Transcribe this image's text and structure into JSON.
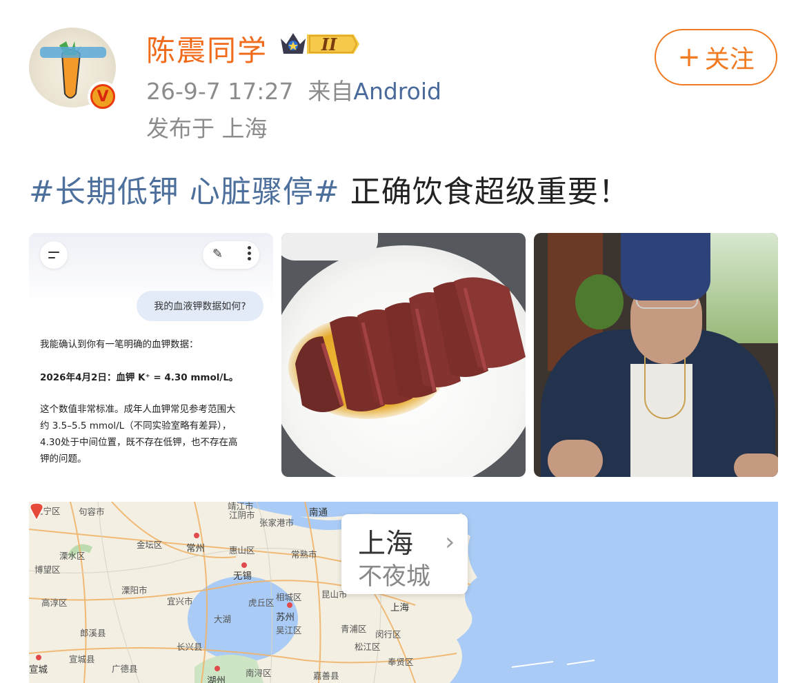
{
  "header": {
    "username": "陈震同学",
    "level_badge": "II",
    "timestamp": "26-9-7 17:27",
    "source_prefix": "来自",
    "source_app": "Android",
    "location_line": "发布于 上海",
    "follow_label": "关注"
  },
  "post": {
    "hashtag": "#长期低钾 心脏骤停#",
    "text": " 正确饮食超级重要！"
  },
  "images": {
    "screenshot": {
      "question": "我的血液钾数据如何?",
      "answer_intro": "我能确认到你有一笔明确的血钾数据：",
      "answer_value": "2026年4月2日：血钾 K⁺ = 4.30 mmol/L。",
      "answer_line1": "这个数值非常标准。成年人血钾常见参考范围大",
      "answer_line2": "约 3.5–5.5 mmol/L（不同实验室略有差异），",
      "answer_line3": "4.30处于中间位置，既不存在低钾，也不存在高",
      "answer_line4": "钾的问题。"
    }
  },
  "map": {
    "popup_title": "上海",
    "popup_subtitle": "不夜城",
    "labels": [
      "江宁区",
      "句容市",
      "靖江市",
      "江阴市",
      "南通",
      "张家港市",
      "金坛区",
      "常州",
      "惠山区",
      "常熟市",
      "溧水区",
      "无锡",
      "博望区",
      "溧阳市",
      "宜兴市",
      "相城区",
      "昆山市",
      "虎丘区",
      "苏州",
      "高淳区",
      "大湖",
      "吴江区",
      "青浦区",
      "闵行区",
      "郎溪县",
      "长兴县",
      "松江区",
      "宣城",
      "宣城县",
      "广德县",
      "湖州",
      "南浔区",
      "嘉善县",
      "奉贤区",
      "上海"
    ]
  },
  "colors": {
    "username": "#f06b1c",
    "hashtag": "#4d6f9c",
    "follow": "#f07b22",
    "meta": "#8c8c8c",
    "sea": "#a9cbf5"
  }
}
